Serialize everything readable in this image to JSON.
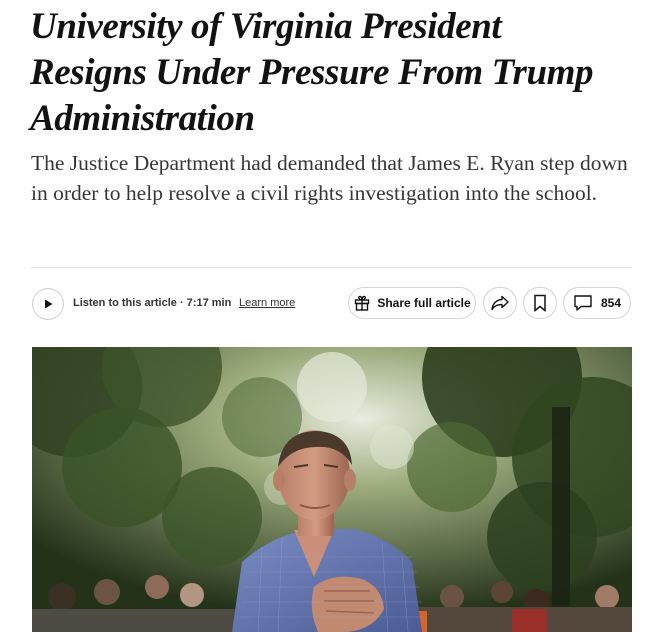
{
  "article": {
    "headline_lines": [
      "University of Virginia President",
      "Resigns Under Pressure From Trump",
      "Administration"
    ],
    "summary": "The Justice Department had demanded that James E. Ryan step down in order to help resolve a civil rights investigation into the school."
  },
  "toolbar": {
    "listen_label": "Listen to this article · 7:17 min",
    "learn_more": "Learn more",
    "share_full_label": "Share full article",
    "comment_count": "854"
  },
  "icons": {
    "play": "play-icon",
    "gift": "gift-icon",
    "share": "share-arrow-icon",
    "bookmark": "bookmark-icon",
    "comment": "comment-bubble-icon"
  }
}
